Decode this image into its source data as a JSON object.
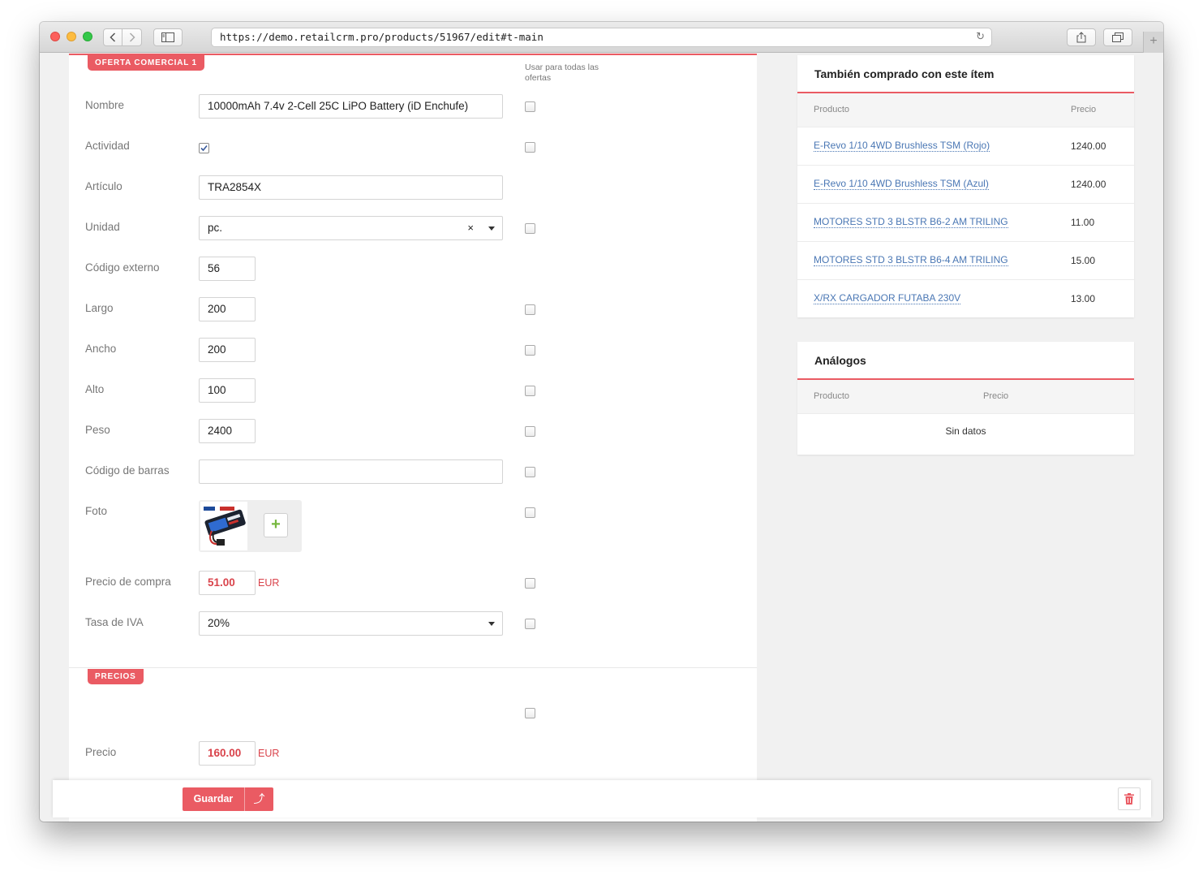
{
  "browser": {
    "url": "https://demo.retailcrm.pro/products/51967/edit#t-main"
  },
  "offer": {
    "tag": "OFERTA COMERCIAL 1",
    "apply_all_label": "Usar para todas las ofertas",
    "fields": {
      "nombre": {
        "label": "Nombre",
        "value": "10000mAh 7.4v 2-Cell 25C LiPO Battery (iD Enchufe)"
      },
      "actividad": {
        "label": "Actividad",
        "checked": true
      },
      "articulo": {
        "label": "Artículo",
        "value": "TRA2854X"
      },
      "unidad": {
        "label": "Unidad",
        "value": "pc.",
        "clear": "×"
      },
      "codigo_externo": {
        "label": "Código externo",
        "value": "56"
      },
      "largo": {
        "label": "Largo",
        "value": "200"
      },
      "ancho": {
        "label": "Ancho",
        "value": "200"
      },
      "alto": {
        "label": "Alto",
        "value": "100"
      },
      "peso": {
        "label": "Peso",
        "value": "2400"
      },
      "codigo_barras": {
        "label": "Código de barras",
        "value": ""
      },
      "foto": {
        "label": "Foto",
        "add": "+"
      },
      "precio_compra": {
        "label": "Precio de compra",
        "value": "51.00",
        "currency": "EUR"
      },
      "tasa_iva": {
        "label": "Tasa de IVA",
        "value": "20%"
      }
    }
  },
  "prices": {
    "tag": "PRECIOS",
    "precio": {
      "label": "Precio",
      "value": "160.00",
      "currency": "EUR"
    }
  },
  "also_bought": {
    "title": "También comprado con este ítem",
    "col_product": "Producto",
    "col_price": "Precio",
    "rows": [
      {
        "name": "E-Revo 1/10 4WD Brushless TSM (Rojo)",
        "price": "1240.00"
      },
      {
        "name": "E-Revo 1/10 4WD Brushless TSM (Azul)",
        "price": "1240.00"
      },
      {
        "name": "MOTORES STD 3 BLSTR B6-2 AM TRILING",
        "price": "11.00"
      },
      {
        "name": "MOTORES STD 3 BLSTR B6-4 AM TRILING",
        "price": "15.00"
      },
      {
        "name": "X/RX CARGADOR FUTABA 230V",
        "price": "13.00"
      }
    ]
  },
  "analogs": {
    "title": "Análogos",
    "col_product": "Producto",
    "col_price": "Precio",
    "empty": "Sin datos"
  },
  "actions": {
    "save": "Guardar",
    "save_arrow": "⤴"
  },
  "colors": {
    "accent": "#ea5b63",
    "link": "#4a77b4",
    "add_green": "#76b83f"
  }
}
